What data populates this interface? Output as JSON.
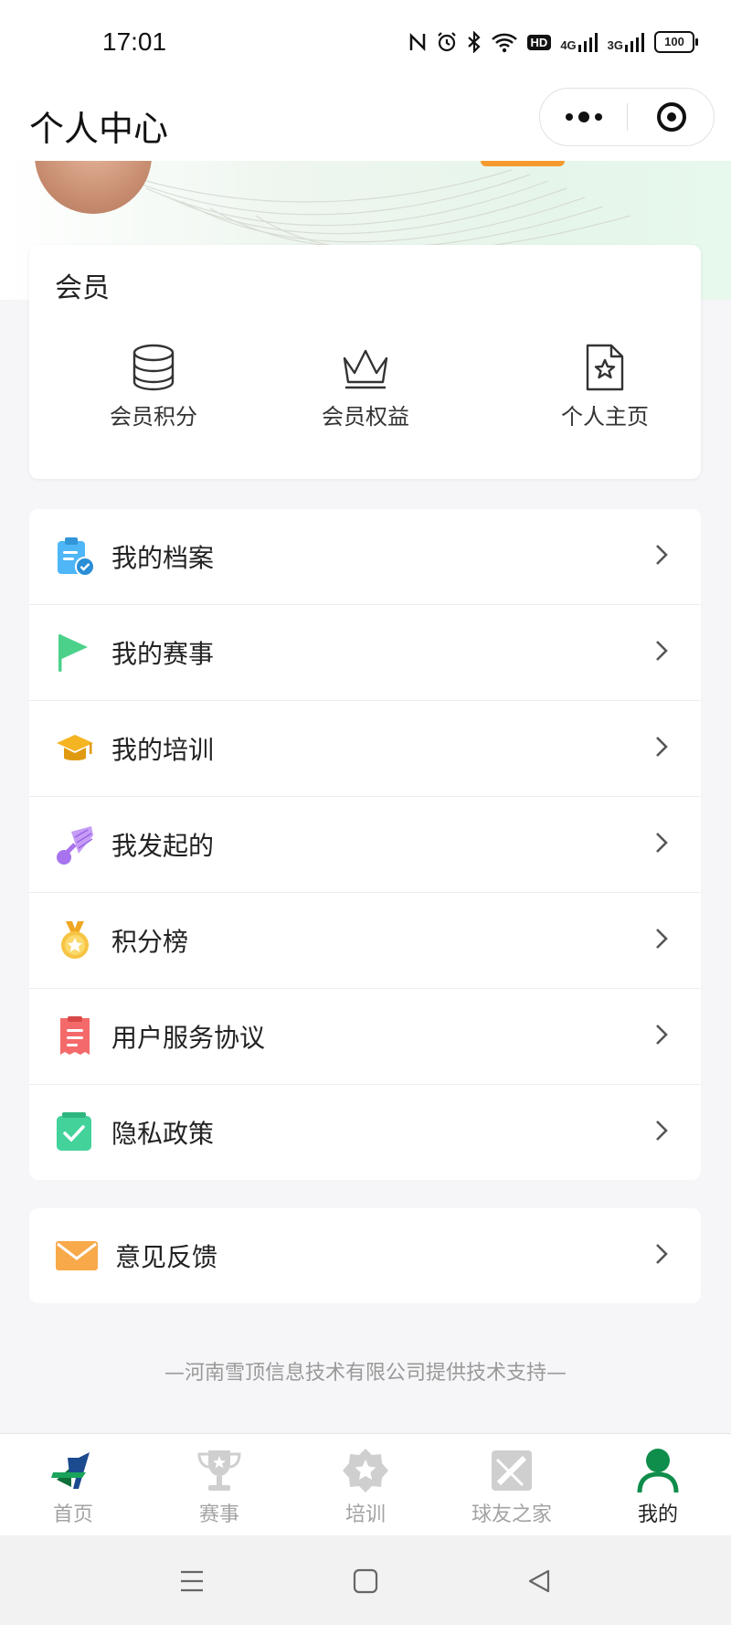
{
  "status_bar": {
    "time": "17:01",
    "icons": [
      "nfc-icon",
      "alarm-icon",
      "bluetooth-icon",
      "wifi-icon",
      "hd-icon",
      "signal-4g-icon",
      "signal-3g-icon",
      "battery-icon"
    ],
    "net1": "4G",
    "net2": "3G",
    "hd": "HD",
    "battery": "100"
  },
  "header": {
    "title": "个人中心",
    "capsule": {
      "more_icon": "more-dots-icon",
      "close_icon": "target-icon"
    }
  },
  "member": {
    "title": "会员",
    "items": [
      {
        "label": "会员积分",
        "icon": "coins-stack-icon"
      },
      {
        "label": "会员权益",
        "icon": "crown-icon"
      },
      {
        "label": "个人主页",
        "icon": "star-document-icon"
      }
    ]
  },
  "menu": [
    {
      "label": "我的档案",
      "icon": "clipboard-check-icon",
      "color": "#4fb6f7"
    },
    {
      "label": "我的赛事",
      "icon": "flag-icon",
      "color": "#4cd18a"
    },
    {
      "label": "我的培训",
      "icon": "graduation-cap-icon",
      "color": "#f5b422"
    },
    {
      "label": "我发起的",
      "icon": "shuttlecock-icon",
      "color": "#b886f2"
    },
    {
      "label": "积分榜",
      "icon": "medal-icon",
      "color": "#f6c343"
    },
    {
      "label": "用户服务协议",
      "icon": "receipt-icon",
      "color": "#f46a6a"
    },
    {
      "label": "隐私政策",
      "icon": "checkbox-icon",
      "color": "#42d29a"
    }
  ],
  "feedback": {
    "label": "意见反馈",
    "icon": "envelope-icon",
    "color": "#f8a94a"
  },
  "footer_note": "—河南雪顶信息技术有限公司提供技术支持—",
  "tabs": [
    {
      "label": "首页",
      "icon": "home-logo-icon",
      "active": false
    },
    {
      "label": "赛事",
      "icon": "trophy-icon",
      "active": false
    },
    {
      "label": "培训",
      "icon": "star-badge-icon",
      "active": false
    },
    {
      "label": "球友之家",
      "icon": "racket-icon",
      "active": false
    },
    {
      "label": "我的",
      "icon": "user-icon",
      "active": true
    }
  ],
  "colors": {
    "accent_green": "#0f8d4a",
    "inactive_gray": "#a3a3a3"
  }
}
